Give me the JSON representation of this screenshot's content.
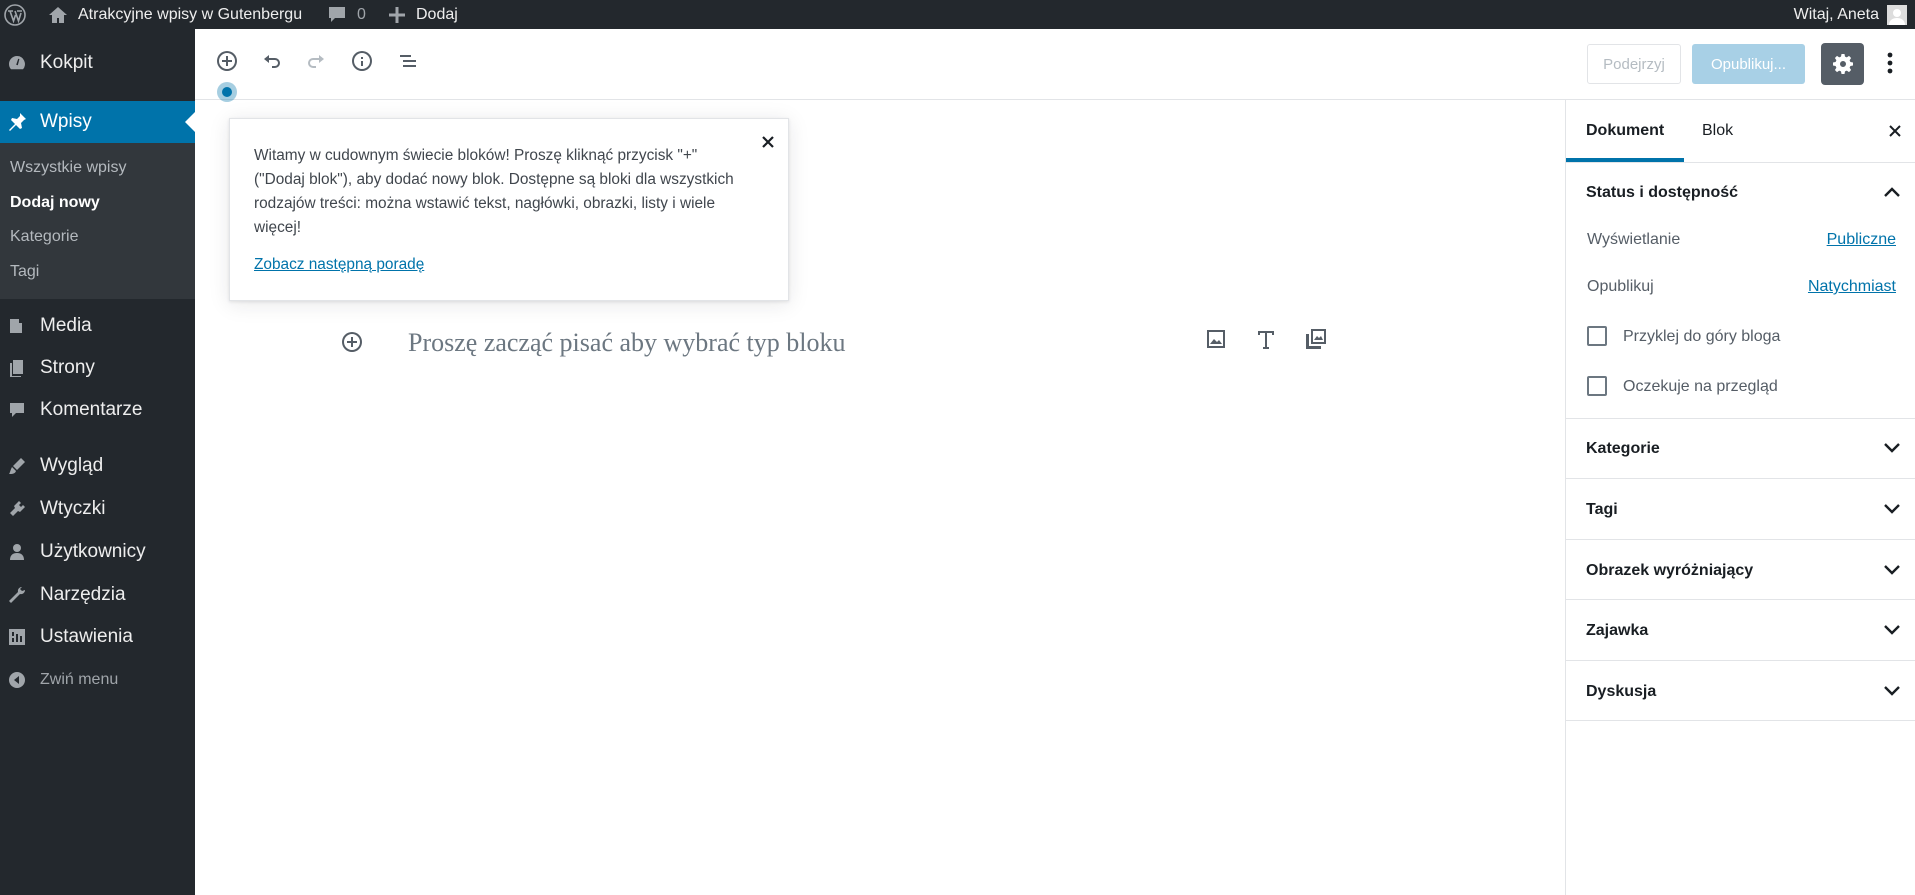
{
  "admin_bar": {
    "site_name": "Atrakcyjne wpisy w Gutenbergu",
    "comments_count": "0",
    "add_new": "Dodaj",
    "greeting": "Witaj, Aneta"
  },
  "sidebar": {
    "items": [
      {
        "label": "Kokpit",
        "icon": "dashboard-icon"
      },
      {
        "label": "Wpisy",
        "icon": "pin-icon"
      },
      {
        "label": "Media",
        "icon": "media-icon"
      },
      {
        "label": "Strony",
        "icon": "pages-icon"
      },
      {
        "label": "Komentarze",
        "icon": "comments-icon"
      },
      {
        "label": "Wygląd",
        "icon": "appearance-icon"
      },
      {
        "label": "Wtyczki",
        "icon": "plugins-icon"
      },
      {
        "label": "Użytkownicy",
        "icon": "users-icon"
      },
      {
        "label": "Narzędzia",
        "icon": "tools-icon"
      },
      {
        "label": "Ustawienia",
        "icon": "settings-icon"
      }
    ],
    "submenu": [
      "Wszystkie wpisy",
      "Dodaj nowy",
      "Kategorie",
      "Tagi"
    ],
    "collapse_label": "Zwiń menu"
  },
  "toolbar": {
    "preview_label": "Podejrzyj",
    "publish_label": "Opublikuj..."
  },
  "tip": {
    "text": "Witamy w cudownym świecie bloków! Proszę kliknąć przycisk \"+\" (\"Dodaj blok\"), aby dodać nowy blok. Dostępne są bloki dla wszystkich rodzajów treści: można wstawić tekst, nagłówki, obrazki, listy i wiele więcej!",
    "next_link": "Zobacz następną poradę"
  },
  "editor": {
    "placeholder": "Proszę zacząć pisać aby wybrać typ bloku"
  },
  "settings_sidebar": {
    "tabs": [
      "Dokument",
      "Blok"
    ],
    "status_panel": {
      "title": "Status i dostępność",
      "visibility_label": "Wyświetlanie",
      "visibility_value": "Publiczne",
      "publish_label": "Opublikuj",
      "publish_value": "Natychmiast",
      "sticky_label": "Przyklej do góry bloga",
      "pending_label": "Oczekuje na przegląd"
    },
    "panels": [
      "Kategorie",
      "Tagi",
      "Obrazek wyróżniający",
      "Zajawka",
      "Dyskusja"
    ]
  },
  "colors": {
    "accent": "#0073aa",
    "admin_dark": "#23282d",
    "submenu_bg": "#32373c"
  }
}
